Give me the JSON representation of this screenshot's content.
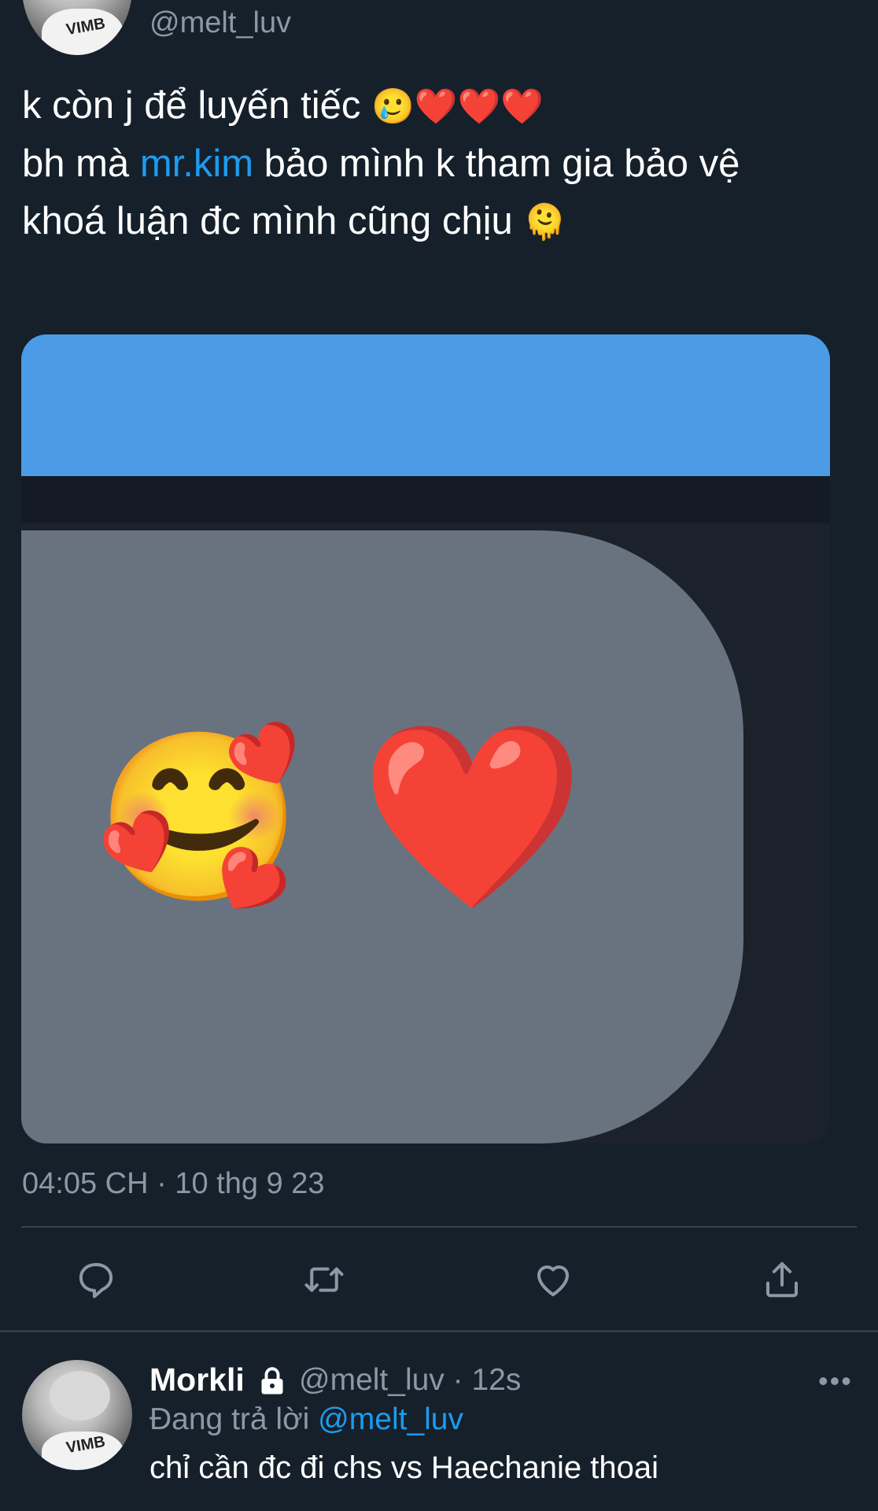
{
  "tweet": {
    "handle": "@melt_luv",
    "line1_text": "k còn j để luyến tiếc",
    "line1_emojis": "🥲❤️❤️❤️",
    "line2_prefix": "bh mà ",
    "line2_mention": "mr.kim",
    "line2_suffix": " bảo mình k tham gia bảo vệ",
    "line3_text": "khoá luận đc mình cũng chịu",
    "line3_emoji": "🫠",
    "image": {
      "emoji_1": "🥰",
      "emoji_2": "❤️"
    },
    "timestamp": "04:05 CH · 10 thg 9 23"
  },
  "actions": [
    {
      "name": "reply",
      "icon": "reply-icon"
    },
    {
      "name": "retweet",
      "icon": "retweet-icon"
    },
    {
      "name": "like",
      "icon": "heart-icon"
    },
    {
      "name": "share",
      "icon": "share-icon"
    }
  ],
  "reply": {
    "name": "Morkli",
    "handle_time": "@melt_luv · 12s",
    "replying_prefix": "Đang trả lời ",
    "replying_mention": "@melt_luv",
    "text": "chỉ cần đc đi chs vs Haechanie thoai",
    "more": "•••"
  },
  "colors": {
    "background": "#15202b",
    "accent": "#1d9bf0",
    "muted": "#8b98a5"
  }
}
